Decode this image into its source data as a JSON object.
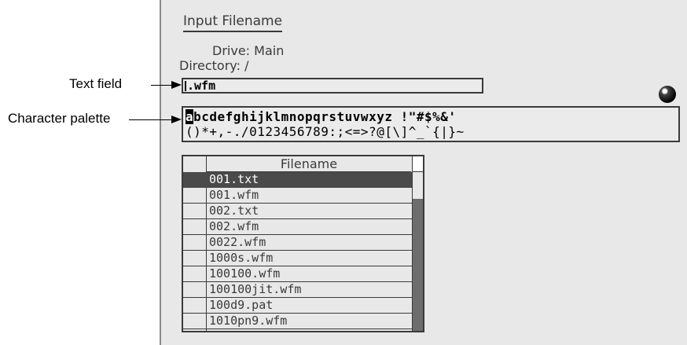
{
  "dialog": {
    "title": "Input Filename",
    "drive_label": "Drive:",
    "drive_value": "Main",
    "directory_label": "Directory:",
    "directory_value": "/"
  },
  "callouts": {
    "text_field": "Text field",
    "character_palette": "Character palette"
  },
  "text_field": {
    "value": ".wfm"
  },
  "palette": {
    "selected_char": "a",
    "row1_rest": "bcdefghijklmnopqrstuvwxyz !\"#$%&'",
    "row2": "()*+,-./0123456789:;<=>?@[\\]^_`{|}~"
  },
  "file_table": {
    "header": "Filename",
    "rows": [
      "001.txt",
      "001.wfm",
      "002.txt",
      "002.wfm",
      "0022.wfm",
      "1000s.wfm",
      "100100.wfm",
      "100100jit.wfm",
      "100d9.pat",
      "1010pn9.wfm"
    ],
    "selected_index": 0
  }
}
